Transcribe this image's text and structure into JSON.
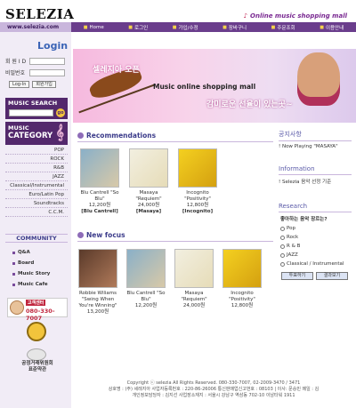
{
  "header": {
    "logo": "SELEZIA",
    "tagline": "Online music shopping mall",
    "tagline_icon": "music-note-icon",
    "url": "www.selezia.com"
  },
  "nav": {
    "items": [
      {
        "label": "Home",
        "icon": "home-icon"
      },
      {
        "label": "로그인",
        "icon": "login-icon"
      },
      {
        "label": "가입/수정",
        "icon": "user-icon"
      },
      {
        "label": "장바구니",
        "icon": "cart-icon"
      },
      {
        "label": "주문조회",
        "icon": "order-icon"
      },
      {
        "label": "이용안내",
        "icon": "info-icon"
      }
    ]
  },
  "login": {
    "title": "Login",
    "id_label": "회 원 I D",
    "pw_label": "비밀번호",
    "login_button": "Log-In",
    "join_button": "회원가입"
  },
  "search": {
    "title": "MUSIC SEARCH",
    "go_label": "go"
  },
  "category": {
    "title_top": "MUSIC",
    "title_bottom": "CATEGORY",
    "items": [
      "POP",
      "ROCK",
      "R&B",
      "JAZZ",
      "Classical/Instrumental",
      "Euro/Latin Pop",
      "Soundtracks",
      "C.C.M."
    ]
  },
  "community": {
    "title": "COMMUNITY",
    "items": [
      "Q&A",
      "Board",
      "Music Story",
      "Music Cafe"
    ]
  },
  "callcenter": {
    "label": "고객센터",
    "phone": "080-330-7007"
  },
  "cert": {
    "line1": "공정거래위원회",
    "line2": "표준약관"
  },
  "banner": {
    "text_top": "셀레지아 오픈",
    "text_main": "Music online shopping mall",
    "text_bottom": "감미로운 선율이 있는곳~"
  },
  "recommendations": {
    "title": "Recommendations",
    "albums": [
      {
        "title": "Blu Cantrell \"So Blu\"",
        "price": "12,200원",
        "tag": "[Blu Cantrell]",
        "cover": "c1"
      },
      {
        "title": "Masaya \"Requiem\"",
        "price": "24,000원",
        "tag": "[Masaya]",
        "cover": "c2"
      },
      {
        "title": "Incognito \"Positivity\"",
        "price": "12,800원",
        "tag": "[Incognito]",
        "cover": "c3"
      }
    ]
  },
  "new_focus": {
    "title": "New focus",
    "albums": [
      {
        "title": "Robbie Wiliams \"Swing When You're Winning\"",
        "price": "13,200원",
        "cover": "c4"
      },
      {
        "title": "Blu Cantrell \"So Blu\"",
        "price": "12,200원",
        "cover": "c1"
      },
      {
        "title": "Masaya \"Requiem\"",
        "price": "24,000원",
        "cover": "c2"
      },
      {
        "title": "Incognito \"Positivity\"",
        "price": "12,800원",
        "cover": "c3"
      }
    ]
  },
  "notice": {
    "title": "공지사항",
    "text": "! Now Playing \"MASAYA\""
  },
  "information": {
    "title": "Information",
    "text": "! Selezia 음악 선정 기준"
  },
  "research": {
    "title": "Research",
    "question": "좋아하는 음악 장르는?",
    "options": [
      "Pop",
      "Rock",
      "R & B",
      "JAZZ",
      "Classical / Instrumental"
    ],
    "vote_button": "투표하기",
    "result_button": "결과보기"
  },
  "footer": {
    "line1": "Copyright ⓒ selezia All Rights Reserved. 080-330-7007, 02-2009-3470 / 3471",
    "line2": "상호명 : (주) 세레지아   사업자등록번호 : 220-86-26006   통신판매업신고번호 : 08103 | 이사: 문승민  메일 : 김",
    "line3": "개인정보담당자 : 김지선   사업장소재지 : 서울시 강남구 역삼동 702-10 이남타워 1911"
  },
  "colors": {
    "nav_purple": "#6a3d8c",
    "sidebar_bg": "#f1ecf6",
    "heading_blue": "#3b3b8a",
    "accent_pink": "#c0263e"
  }
}
